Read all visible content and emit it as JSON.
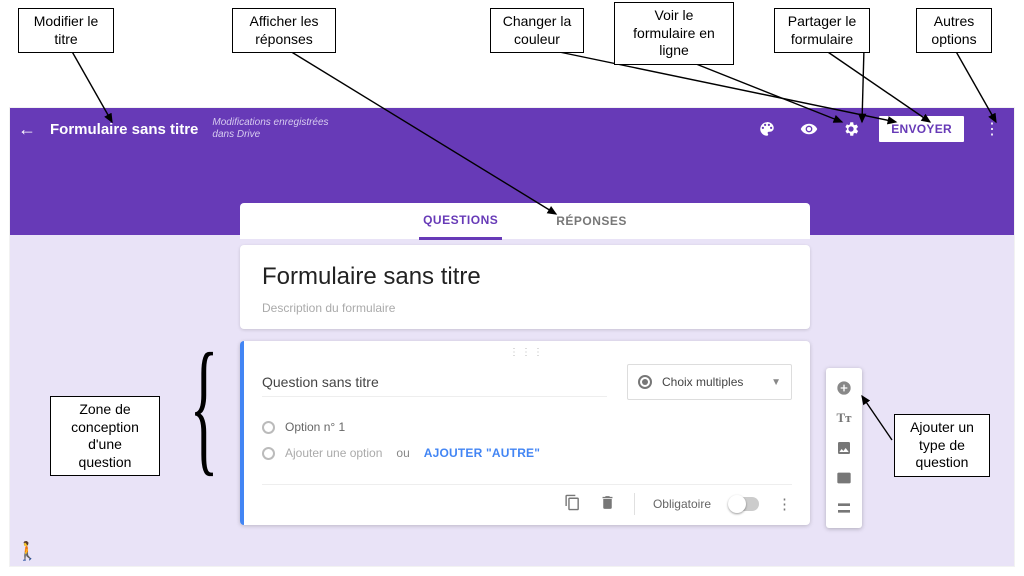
{
  "callouts": {
    "edit_title": "Modifier le\ntitre",
    "show_responses": "Afficher les\nréponses",
    "change_color": "Changer la\ncouleur",
    "view_online": "Voir le\nformulaire en\nligne",
    "share_form": "Partager le\nformulaire",
    "more_options": "Autres\noptions",
    "design_zone": "Zone de\nconception\nd'une\nquestion",
    "add_qtype": "Ajouter un\ntype de\nquestion"
  },
  "topbar": {
    "back_icon": "←",
    "title": "Formulaire sans titre",
    "saved": "Modifications enregistrées\ndans Drive",
    "send": "ENVOYER",
    "more_icon": "⋮"
  },
  "tabs": {
    "questions": "QUESTIONS",
    "responses": "RÉPONSES"
  },
  "form": {
    "title": "Formulaire sans titre",
    "description_placeholder": "Description du formulaire"
  },
  "question": {
    "title": "Question sans titre",
    "type_label": "Choix multiples",
    "option1": "Option n° 1",
    "add_option": "Ajouter une option",
    "or": "ou",
    "add_other": "AJOUTER \"AUTRE\"",
    "required": "Obligatoire"
  },
  "icons": {
    "palette": "palette-icon",
    "eye": "eye-icon",
    "gear": "gear-icon",
    "copy": "copy-icon",
    "trash": "trash-icon",
    "add": "add-icon",
    "text": "text-icon",
    "image": "image-icon",
    "video": "video-icon",
    "section": "section-icon"
  }
}
